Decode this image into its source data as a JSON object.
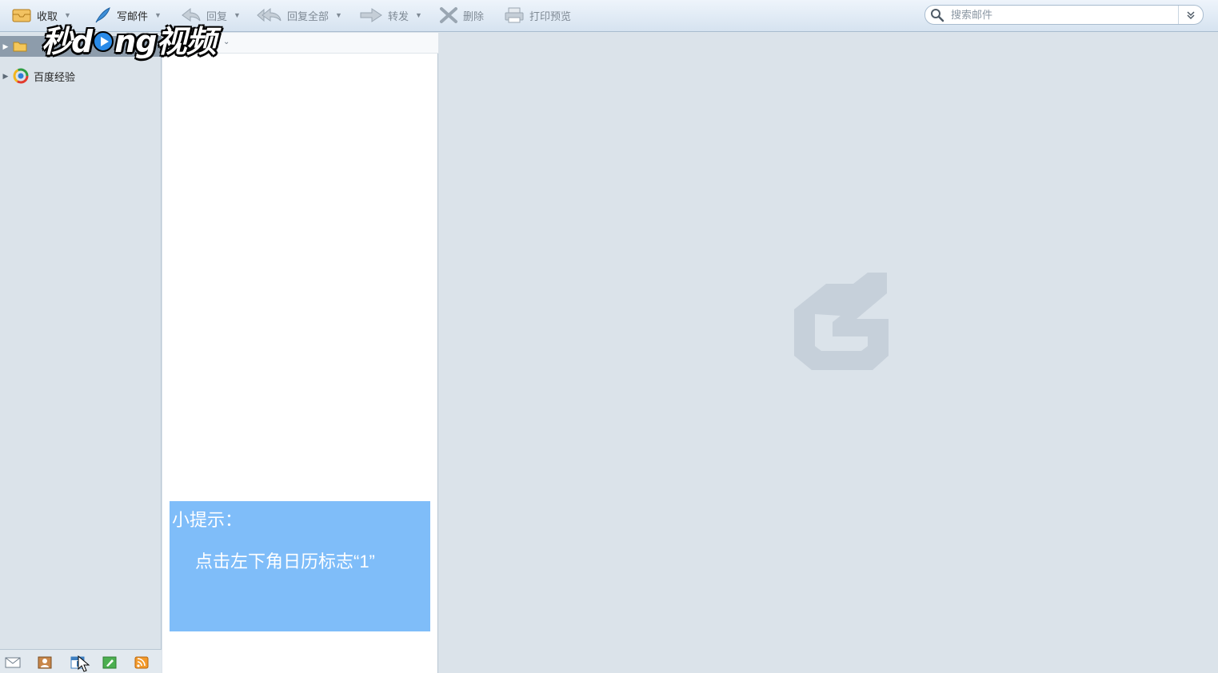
{
  "toolbar": {
    "receive_label": "收取",
    "compose_label": "写邮件",
    "reply_label": "回复",
    "reply_all_label": "回复全部",
    "forward_label": "转发",
    "delete_label": "删除",
    "print_preview_label": "打印预览"
  },
  "search": {
    "placeholder": "搜索邮件"
  },
  "watermark": {
    "text_a": "秒d",
    "text_b": "ng视频"
  },
  "folders": [
    {
      "label": ""
    },
    {
      "label": "百度经验"
    }
  ],
  "tip": {
    "title": "小提示：",
    "text": "点击左下角日历标志“1”"
  }
}
